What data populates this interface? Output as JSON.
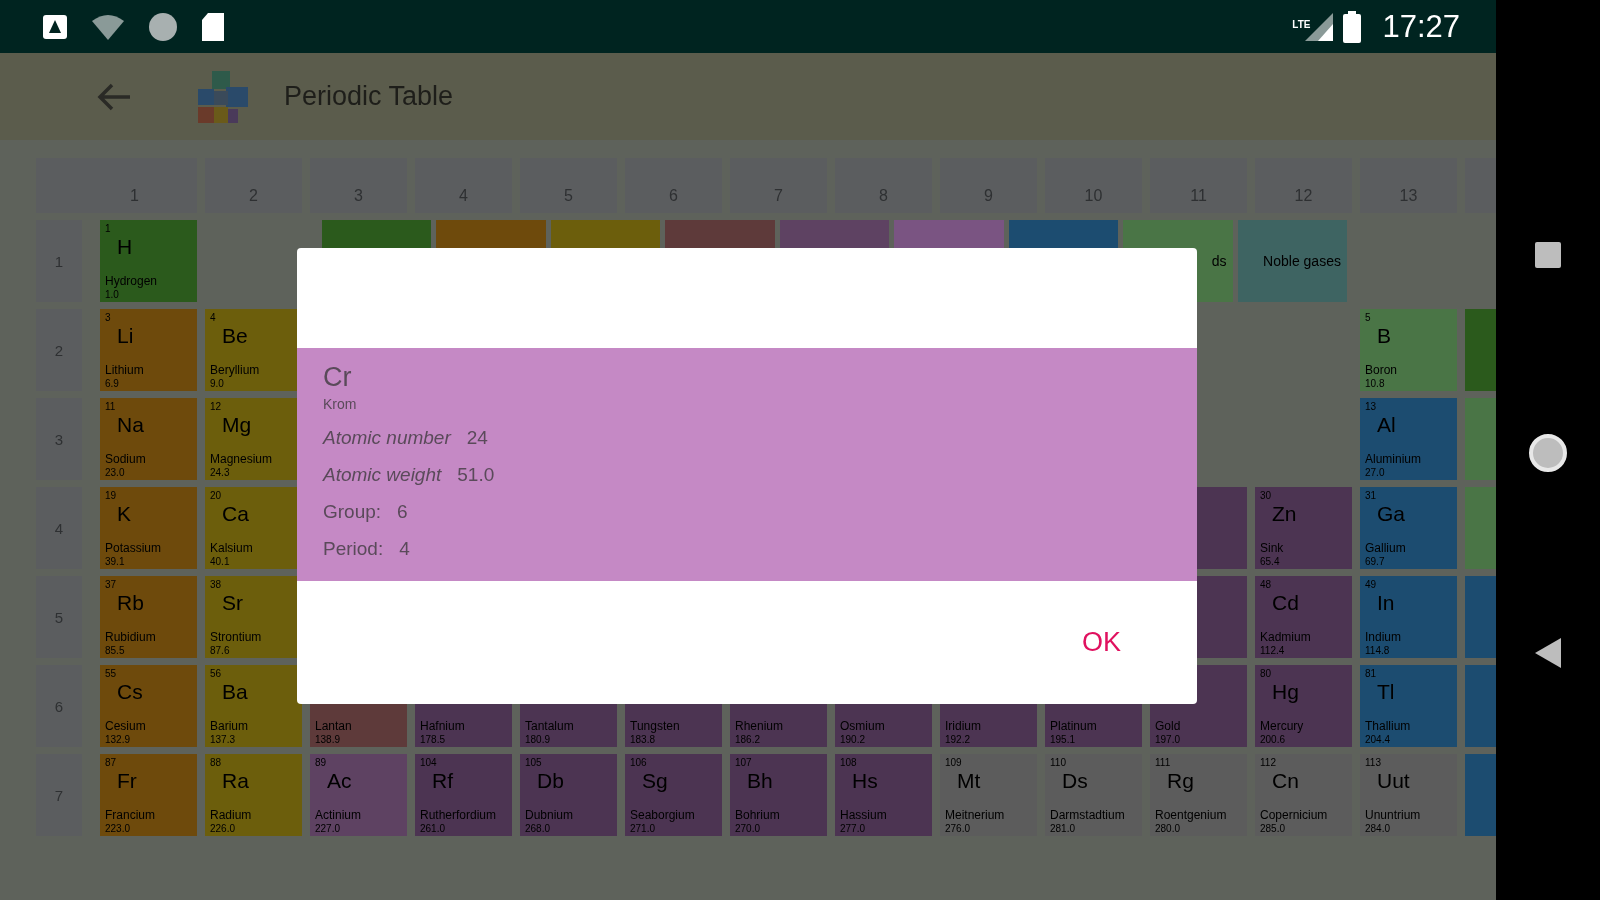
{
  "status_bar": {
    "network_label": "LTE",
    "time": "17:27"
  },
  "app_bar": {
    "title": "Periodic Table"
  },
  "table": {
    "group_headers": [
      "1",
      "2",
      "3",
      "4",
      "5",
      "6",
      "7",
      "8",
      "9",
      "10",
      "11",
      "12",
      "13"
    ],
    "legend": [
      {
        "color": "#2b5a1c"
      },
      {
        "color": "#6e4a0c"
      },
      {
        "color": "#6c5e0c"
      },
      {
        "color": "#5e3a3a"
      },
      {
        "color": "#5e4262"
      },
      {
        "color": "#7a5482"
      },
      {
        "color": "#1c4c70"
      },
      {
        "color": "#4a7546",
        "label": "ds"
      },
      {
        "color": "#3e6462",
        "label": "Noble gases"
      }
    ],
    "rows": [
      {
        "label": "1",
        "cells": [
          {
            "kind": "element",
            "color": "#2b5a1c",
            "number": "1",
            "symbol": "H",
            "name": "Hydrogen",
            "weight": "1.0"
          }
        ]
      },
      {
        "label": "2",
        "cells": [
          {
            "kind": "element",
            "color": "#6e4a0c",
            "number": "3",
            "symbol": "Li",
            "name": "Lithium",
            "weight": "6.9"
          },
          {
            "kind": "element",
            "color": "#6c5e0c",
            "number": "4",
            "symbol": "Be",
            "name": "Beryllium",
            "weight": "9.0"
          },
          {
            "kind": "gap"
          },
          {
            "kind": "gap"
          },
          {
            "kind": "gap"
          },
          {
            "kind": "gap"
          },
          {
            "kind": "gap"
          },
          {
            "kind": "gap"
          },
          {
            "kind": "gap"
          },
          {
            "kind": "gap"
          },
          {
            "kind": "gap"
          },
          {
            "kind": "gap"
          },
          {
            "kind": "element",
            "color": "#4a7546",
            "number": "5",
            "symbol": "B",
            "name": "Boron",
            "weight": "10.8"
          },
          {
            "kind": "blank",
            "color": "#2b5a1c"
          }
        ]
      },
      {
        "label": "3",
        "cells": [
          {
            "kind": "element",
            "color": "#6e4a0c",
            "number": "11",
            "symbol": "Na",
            "name": "Sodium",
            "weight": "23.0"
          },
          {
            "kind": "element",
            "color": "#6c5e0c",
            "number": "12",
            "symbol": "Mg",
            "name": "Magnesium",
            "weight": "24.3"
          },
          {
            "kind": "gap"
          },
          {
            "kind": "gap"
          },
          {
            "kind": "gap"
          },
          {
            "kind": "gap"
          },
          {
            "kind": "gap"
          },
          {
            "kind": "gap"
          },
          {
            "kind": "gap"
          },
          {
            "kind": "gap"
          },
          {
            "kind": "gap"
          },
          {
            "kind": "gap"
          },
          {
            "kind": "element",
            "color": "#1c4c70",
            "number": "13",
            "symbol": "Al",
            "name": "Aluminium",
            "weight": "27.0"
          },
          {
            "kind": "blank",
            "color": "#4a7546"
          }
        ]
      },
      {
        "label": "4",
        "cells": [
          {
            "kind": "element",
            "color": "#6e4a0c",
            "number": "19",
            "symbol": "K",
            "name": "Potassium",
            "weight": "39.1"
          },
          {
            "kind": "element",
            "color": "#6c5e0c",
            "number": "20",
            "symbol": "Ca",
            "name": "Kalsium",
            "weight": "40.1"
          },
          {
            "kind": "gap"
          },
          {
            "kind": "gap"
          },
          {
            "kind": "gap"
          },
          {
            "kind": "gap"
          },
          {
            "kind": "gap"
          },
          {
            "kind": "gap"
          },
          {
            "kind": "gap"
          },
          {
            "kind": "gap"
          },
          {
            "kind": "blank",
            "color": "#4c3452"
          },
          {
            "kind": "element",
            "color": "#4c3452",
            "number": "30",
            "symbol": "Zn",
            "name": "Sink",
            "weight": "65.4"
          },
          {
            "kind": "element",
            "color": "#1c4c70",
            "number": "31",
            "symbol": "Ga",
            "name": "Gallium",
            "weight": "69.7"
          },
          {
            "kind": "blank",
            "color": "#4a7546"
          }
        ]
      },
      {
        "label": "5",
        "cells": [
          {
            "kind": "element",
            "color": "#6e4a0c",
            "number": "37",
            "symbol": "Rb",
            "name": "Rubidium",
            "weight": "85.5"
          },
          {
            "kind": "element",
            "color": "#6c5e0c",
            "number": "38",
            "symbol": "Sr",
            "name": "Strontium",
            "weight": "87.6"
          },
          {
            "kind": "gap"
          },
          {
            "kind": "gap"
          },
          {
            "kind": "gap"
          },
          {
            "kind": "gap"
          },
          {
            "kind": "gap"
          },
          {
            "kind": "gap"
          },
          {
            "kind": "gap"
          },
          {
            "kind": "gap"
          },
          {
            "kind": "blank",
            "color": "#4c3452"
          },
          {
            "kind": "element",
            "color": "#4c3452",
            "number": "48",
            "symbol": "Cd",
            "name": "Kadmium",
            "weight": "112.4"
          },
          {
            "kind": "element",
            "color": "#1c4c70",
            "number": "49",
            "symbol": "In",
            "name": "Indium",
            "weight": "114.8"
          },
          {
            "kind": "blank",
            "color": "#1c4c70"
          }
        ]
      },
      {
        "label": "6",
        "cells": [
          {
            "kind": "element",
            "color": "#6e4a0c",
            "number": "55",
            "symbol": "Cs",
            "name": "Cesium",
            "weight": "132.9"
          },
          {
            "kind": "element",
            "color": "#6c5e0c",
            "number": "56",
            "symbol": "Ba",
            "name": "Barium",
            "weight": "137.3"
          },
          {
            "kind": "element",
            "color": "#5e3a3a",
            "name": "Lantan",
            "weight": "138.9"
          },
          {
            "kind": "element",
            "color": "#4c3452",
            "name": "Hafnium",
            "weight": "178.5"
          },
          {
            "kind": "element",
            "color": "#4c3452",
            "name": "Tantalum",
            "weight": "180.9"
          },
          {
            "kind": "element",
            "color": "#4c3452",
            "name": "Tungsten",
            "weight": "183.8"
          },
          {
            "kind": "element",
            "color": "#4c3452",
            "name": "Rhenium",
            "weight": "186.2"
          },
          {
            "kind": "element",
            "color": "#4c3452",
            "name": "Osmium",
            "weight": "190.2"
          },
          {
            "kind": "element",
            "color": "#4c3452",
            "name": "Iridium",
            "weight": "192.2"
          },
          {
            "kind": "element",
            "color": "#4c3452",
            "name": "Platinum",
            "weight": "195.1"
          },
          {
            "kind": "element",
            "color": "#4c3452",
            "name": "Gold",
            "weight": "197.0"
          },
          {
            "kind": "element",
            "color": "#4c3452",
            "number": "80",
            "symbol": "Hg",
            "name": "Mercury",
            "weight": "200.6"
          },
          {
            "kind": "element",
            "color": "#1c4c70",
            "number": "81",
            "symbol": "Tl",
            "name": "Thallium",
            "weight": "204.4"
          },
          {
            "kind": "blank",
            "color": "#1c4c70"
          }
        ]
      },
      {
        "label": "7",
        "cells": [
          {
            "kind": "element",
            "color": "#6e4a0c",
            "number": "87",
            "symbol": "Fr",
            "name": "Francium",
            "weight": "223.0"
          },
          {
            "kind": "element",
            "color": "#6c5e0c",
            "number": "88",
            "symbol": "Ra",
            "name": "Radium",
            "weight": "226.0"
          },
          {
            "kind": "element",
            "color": "#5e4262",
            "number": "89",
            "symbol": "Ac",
            "name": "Actinium",
            "weight": "227.0"
          },
          {
            "kind": "element",
            "color": "#4c3452",
            "number": "104",
            "symbol": "Rf",
            "name": "Rutherfordium",
            "weight": "261.0"
          },
          {
            "kind": "element",
            "color": "#4c3452",
            "number": "105",
            "symbol": "Db",
            "name": "Dubnium",
            "weight": "268.0"
          },
          {
            "kind": "element",
            "color": "#4c3452",
            "number": "106",
            "symbol": "Sg",
            "name": "Seaborgium",
            "weight": "271.0"
          },
          {
            "kind": "element",
            "color": "#4c3452",
            "number": "107",
            "symbol": "Bh",
            "name": "Bohrium",
            "weight": "270.0"
          },
          {
            "kind": "element",
            "color": "#4c3452",
            "number": "108",
            "symbol": "Hs",
            "name": "Hassium",
            "weight": "277.0"
          },
          {
            "kind": "element",
            "color": "#5c5c5c",
            "number": "109",
            "symbol": "Mt",
            "name": "Meitnerium",
            "weight": "276.0"
          },
          {
            "kind": "element",
            "color": "#5c5c5c",
            "number": "110",
            "symbol": "Ds",
            "name": "Darmstadtium",
            "weight": "281.0"
          },
          {
            "kind": "element",
            "color": "#5c5c5c",
            "number": "111",
            "symbol": "Rg",
            "name": "Roentgenium",
            "weight": "280.0"
          },
          {
            "kind": "element",
            "color": "#5c5c5c",
            "number": "112",
            "symbol": "Cn",
            "name": "Copernicium",
            "weight": "285.0"
          },
          {
            "kind": "element",
            "color": "#5c5c5c",
            "number": "113",
            "symbol": "Uut",
            "name": "Ununtrium",
            "weight": "284.0"
          },
          {
            "kind": "blank",
            "color": "#1c4c70"
          }
        ]
      }
    ]
  },
  "dialog": {
    "color": "#c589c5",
    "symbol": "Cr",
    "name": "Krom",
    "facts": [
      {
        "label": "Atomic number",
        "value": "24",
        "italic": true
      },
      {
        "label": "Atomic weight",
        "value": "51.0",
        "italic": true
      },
      {
        "label": "Group:",
        "value": "6",
        "italic": false
      },
      {
        "label": "Period:",
        "value": "4",
        "italic": false
      }
    ],
    "button": "OK"
  }
}
